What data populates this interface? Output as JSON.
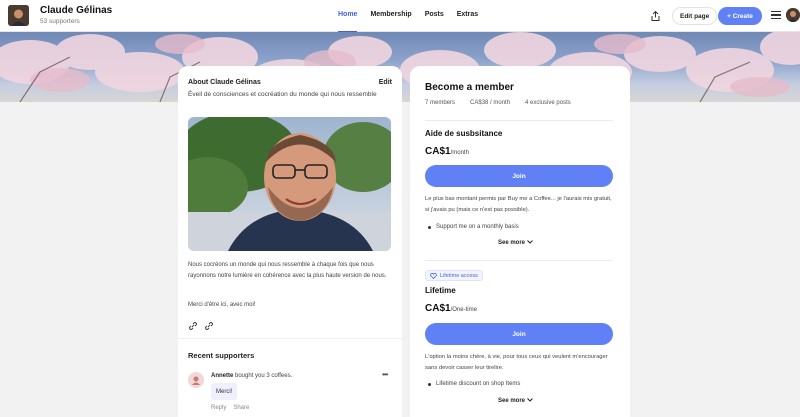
{
  "creator": {
    "name": "Claude Gélinas",
    "supporters": "53 supporters"
  },
  "nav": {
    "items": [
      "Home",
      "Membership",
      "Posts",
      "Extras"
    ]
  },
  "actions": {
    "edit_page": "Edit page",
    "create": "+ Create"
  },
  "about": {
    "title": "About Claude Gélinas",
    "edit": "Edit",
    "tagline": "Éveil de consciences et cocréation du monde qui nous ressemble",
    "description": "Nous cocréons un monde qui nous ressemble à chaque fois que nous rayonnons notre lumière en cohérence avec la plus haute version de nous.",
    "thanks": "Merci d'être ici, avec moi!"
  },
  "recent": {
    "title": "Recent supporters",
    "supporter_name": "Annette",
    "supporter_action": " bought you 3 coffees.",
    "message": "Merci!",
    "reply": "Reply",
    "share": "Share",
    "more": "•••"
  },
  "membership": {
    "title": "Become a member",
    "stats": [
      "7 members",
      "CA$38 / month",
      "4 exclusive posts"
    ],
    "tiers": [
      {
        "name": "Aide de susbsitance",
        "price": "CA$1",
        "period": "/month",
        "join": "Join",
        "description": "Le plus bas montant permis par Buy me a Coffee... je l'aurais mis gratuit, si j'avais pu (mais ce n'est pas possible).",
        "benefit": "Support me on a monthly basis",
        "see_more": "See more"
      },
      {
        "badge": "Lifetime access",
        "name": "Lifetime",
        "price": "CA$1",
        "period": "/One-time",
        "join": "Join",
        "description": "L'option la moins chère, à vie, pour tous ceux qui veulent m'encourager sans devoir casser leur tirelire.",
        "benefit": "Lifetime discount on shop Items",
        "see_more": "See more"
      }
    ]
  },
  "colors": {
    "accent": "#5f81f5",
    "active_nav": "#3f5ee8",
    "page_bg": "#f2f2f2"
  }
}
